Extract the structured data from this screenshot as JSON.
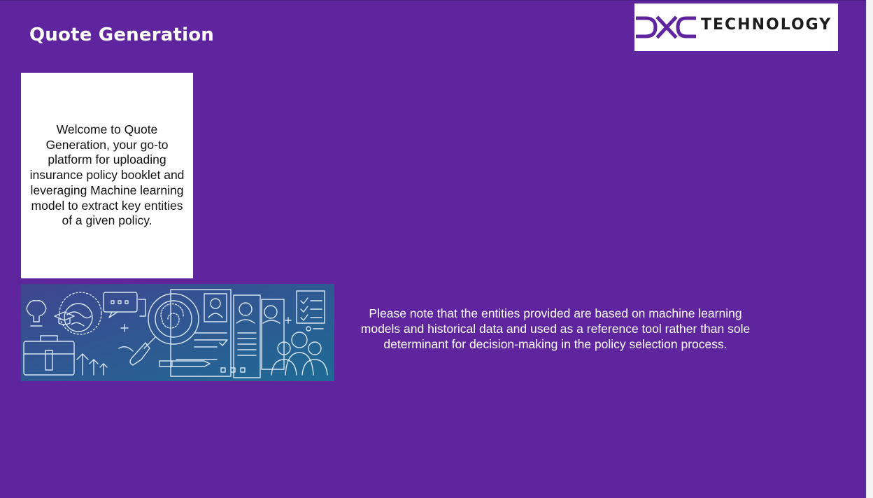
{
  "header": {
    "title": "Quote Generation"
  },
  "logo": {
    "wordmark": "TECHNOLOGY",
    "brand_color": "#5f249f",
    "icon": "dxc-logo-icon"
  },
  "welcome_card": {
    "text": "Welcome to Quote Generation, your go-to platform for uploading insurance policy booklet and leveraging Machine learning model to extract key entities of a given policy."
  },
  "banner": {
    "icon": "recruitment-illustration-icon",
    "colors": {
      "start": "#3b4a8f",
      "end": "#1f6a93"
    }
  },
  "disclaimer": {
    "text": "Please note that the entities provided are based on machine learning models and historical data and used as a reference tool rather than sole determinant for decision-making in the policy selection process."
  },
  "theme": {
    "background": "#5e259e",
    "text_light": "#ffffff"
  }
}
